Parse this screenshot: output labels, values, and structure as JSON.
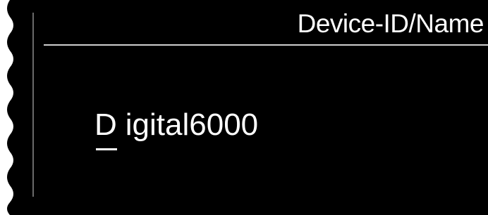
{
  "header": {
    "title": "Device-ID/Name"
  },
  "device_name": {
    "cursor_char": "D",
    "rest": "igital6000"
  },
  "colors": {
    "background": "#000000",
    "text": "#ffffff",
    "separator": "#cfcfcf"
  }
}
